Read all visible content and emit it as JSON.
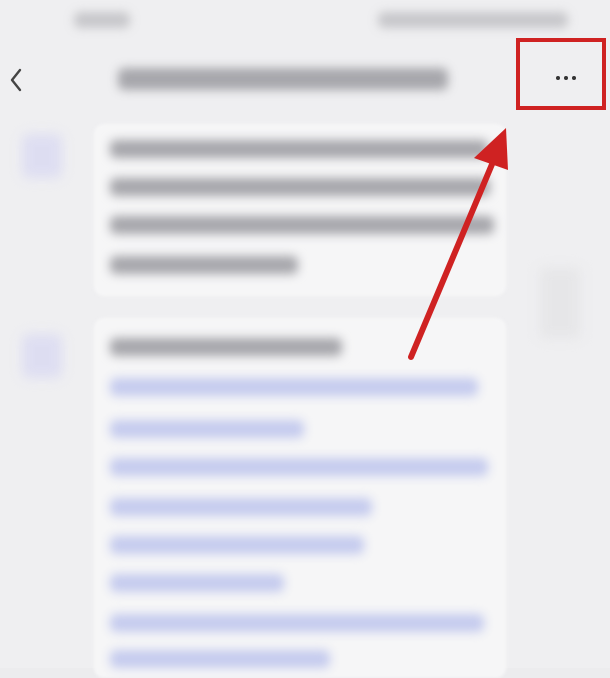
{
  "header": {
    "back_icon": "chevron-left-icon",
    "more_icon": "ellipsis-icon"
  },
  "annotation": {
    "highlight_color": "#cf2222",
    "arrow_color": "#cf2222"
  }
}
